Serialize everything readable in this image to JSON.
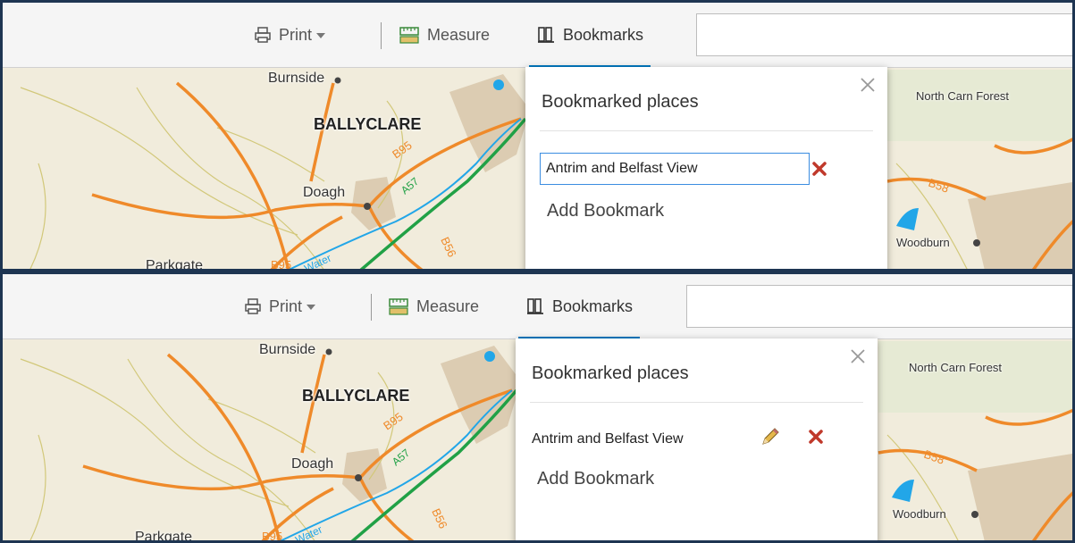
{
  "toolbar": {
    "print_label": "Print",
    "measure_label": "Measure",
    "bookmarks_label": "Bookmarks"
  },
  "map_labels": {
    "burnside": "Burnside",
    "ballyclare": "BALLYCLARE",
    "doagh": "Doagh",
    "parkgate": "Parkgate",
    "north_carn_forest": "North Carn Forest",
    "woodburn": "Woodburn",
    "b95": "B95",
    "b56": "B56",
    "b58": "B58",
    "a57": "A57",
    "water": "Water"
  },
  "panel": {
    "title": "Bookmarked places",
    "add_label": "Add Bookmark"
  },
  "editing": {
    "input_value": "Antrim and Belfast View"
  },
  "saved": {
    "bookmark_name": "Antrim and Belfast View"
  },
  "icons": {
    "print": "printer-icon",
    "measure": "ruler-icon",
    "bookmarks": "bookmarks-icon",
    "close": "close-icon",
    "delete": "delete-x-icon",
    "edit": "pencil-icon"
  },
  "colors": {
    "accent": "#0079c1",
    "delete": "#c0392b",
    "frame": "#1e3552",
    "road_b": "#ef8a2a",
    "road_a": "#21a146",
    "water": "#22a6e8"
  }
}
